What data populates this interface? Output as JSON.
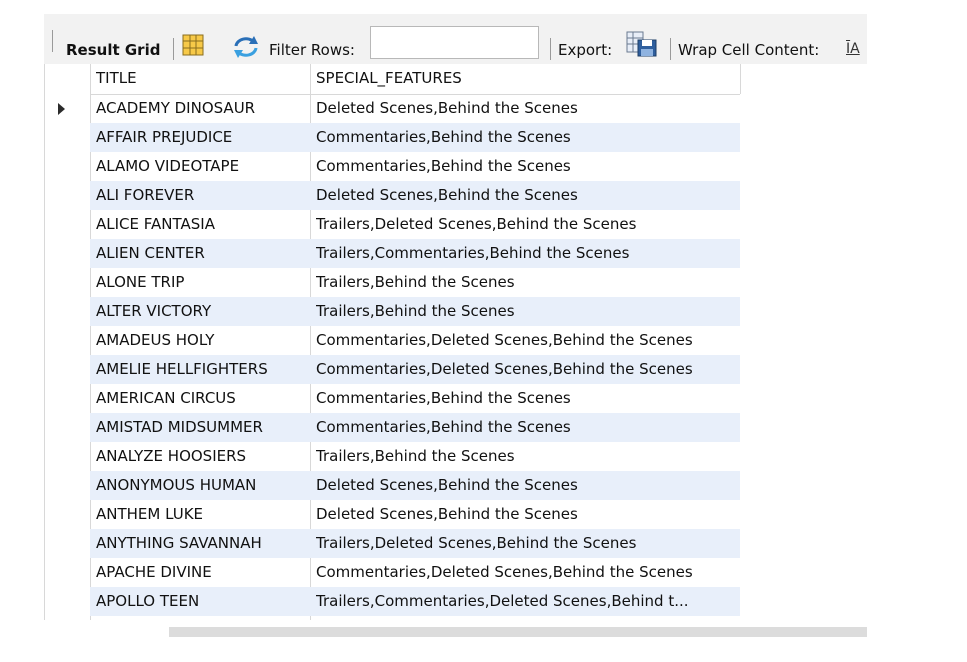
{
  "toolbar": {
    "result_grid_label": "Result Grid",
    "filter_rows_label": "Filter Rows:",
    "filter_rows_value": "",
    "export_label": "Export:",
    "wrap_cell_label": "Wrap Cell Content:",
    "wrap_icon_text": "ĪA"
  },
  "grid": {
    "columns": [
      "TITLE",
      "SPECIAL_FEATURES"
    ],
    "rows": [
      {
        "title": "ACADEMY DINOSAUR",
        "features": "Deleted Scenes,Behind the Scenes"
      },
      {
        "title": "AFFAIR PREJUDICE",
        "features": "Commentaries,Behind the Scenes"
      },
      {
        "title": "ALAMO VIDEOTAPE",
        "features": "Commentaries,Behind the Scenes"
      },
      {
        "title": "ALI FOREVER",
        "features": "Deleted Scenes,Behind the Scenes"
      },
      {
        "title": "ALICE FANTASIA",
        "features": "Trailers,Deleted Scenes,Behind the Scenes"
      },
      {
        "title": "ALIEN CENTER",
        "features": "Trailers,Commentaries,Behind the Scenes"
      },
      {
        "title": "ALONE TRIP",
        "features": "Trailers,Behind the Scenes"
      },
      {
        "title": "ALTER VICTORY",
        "features": "Trailers,Behind the Scenes"
      },
      {
        "title": "AMADEUS HOLY",
        "features": "Commentaries,Deleted Scenes,Behind the Scenes"
      },
      {
        "title": "AMELIE HELLFIGHTERS",
        "features": "Commentaries,Deleted Scenes,Behind the Scenes"
      },
      {
        "title": "AMERICAN CIRCUS",
        "features": "Commentaries,Behind the Scenes"
      },
      {
        "title": "AMISTAD MIDSUMMER",
        "features": "Commentaries,Behind the Scenes"
      },
      {
        "title": "ANALYZE HOOSIERS",
        "features": "Trailers,Behind the Scenes"
      },
      {
        "title": "ANONYMOUS HUMAN",
        "features": "Deleted Scenes,Behind the Scenes"
      },
      {
        "title": "ANTHEM LUKE",
        "features": "Deleted Scenes,Behind the Scenes"
      },
      {
        "title": "ANYTHING SAVANNAH",
        "features": "Trailers,Deleted Scenes,Behind the Scenes"
      },
      {
        "title": "APACHE DIVINE",
        "features": "Commentaries,Deleted Scenes,Behind the Scenes"
      },
      {
        "title": "APOLLO TEEN",
        "features": "Trailers,Commentaries,Deleted Scenes,Behind t..."
      }
    ]
  },
  "colors": {
    "alt_row": "#e8effa",
    "toolbar_bg": "#f2f2f2",
    "grid_line": "#d8d8d8"
  },
  "icons": [
    "result-grid-icon",
    "refresh-icon",
    "export-icon",
    "wrap-cell-icon",
    "row-marker-icon"
  ]
}
